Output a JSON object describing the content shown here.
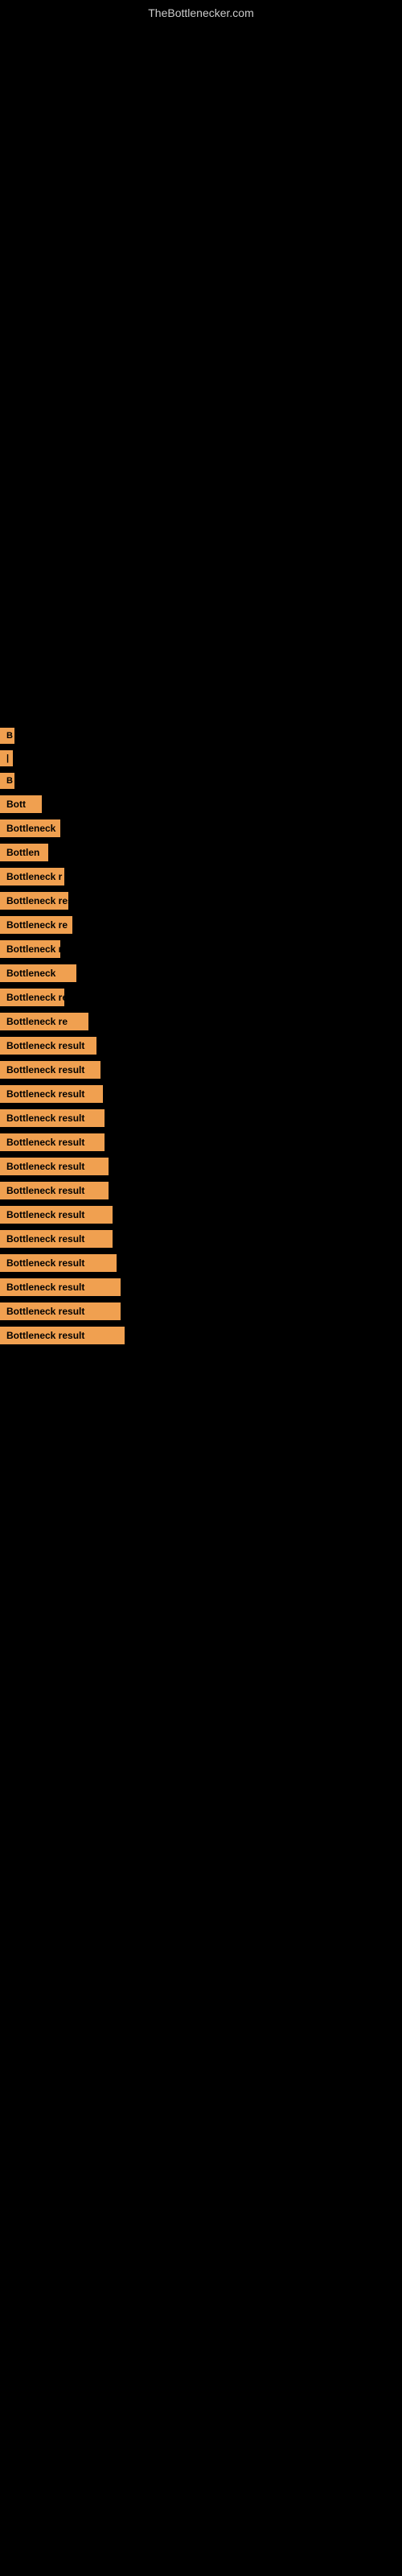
{
  "site": {
    "title": "TheBottlenecker.com"
  },
  "items": [
    {
      "id": 1,
      "label": "B"
    },
    {
      "id": 2,
      "label": "|"
    },
    {
      "id": 3,
      "label": "B"
    },
    {
      "id": 4,
      "label": "Bott"
    },
    {
      "id": 5,
      "label": "Bottleneck"
    },
    {
      "id": 6,
      "label": "Bottlen"
    },
    {
      "id": 7,
      "label": "Bottleneck r"
    },
    {
      "id": 8,
      "label": "Bottleneck resu"
    },
    {
      "id": 9,
      "label": "Bottleneck re"
    },
    {
      "id": 10,
      "label": "Bottleneck re"
    },
    {
      "id": 11,
      "label": "Bottleneck"
    },
    {
      "id": 12,
      "label": "Bottleneck resu"
    },
    {
      "id": 13,
      "label": "Bottleneck re"
    },
    {
      "id": 14,
      "label": "Bottleneck result"
    },
    {
      "id": 15,
      "label": "Bottleneck result"
    },
    {
      "id": 16,
      "label": "Bottleneck result"
    },
    {
      "id": 17,
      "label": "Bottleneck result"
    },
    {
      "id": 18,
      "label": "Bottleneck result"
    },
    {
      "id": 19,
      "label": "Bottleneck result"
    },
    {
      "id": 20,
      "label": "Bottleneck result"
    },
    {
      "id": 21,
      "label": "Bottleneck result"
    },
    {
      "id": 22,
      "label": "Bottleneck result"
    },
    {
      "id": 23,
      "label": "Bottleneck result"
    },
    {
      "id": 24,
      "label": "Bottleneck result"
    },
    {
      "id": 25,
      "label": "Bottleneck result"
    },
    {
      "id": 26,
      "label": "Bottleneck result"
    }
  ]
}
